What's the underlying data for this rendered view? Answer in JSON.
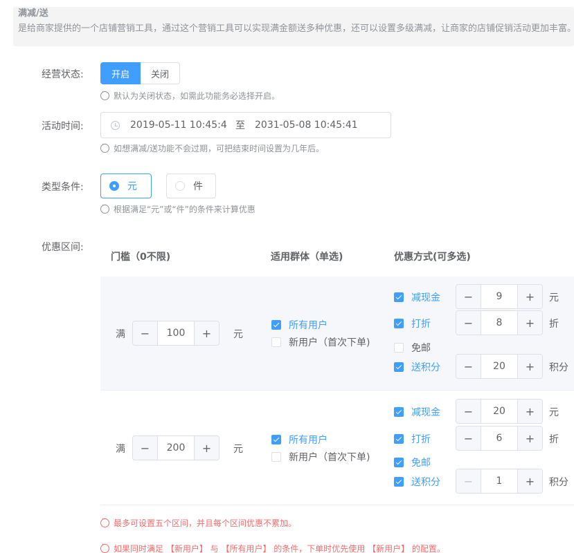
{
  "header": {
    "title": "满减/送",
    "description": "是给商家提供的一个店铺营销工具，通过这个营销工具可以实现满金额送多种优惠，还可以设置多级满减，让商家的店铺促销活动更加丰富。"
  },
  "status": {
    "label": "经营状态:",
    "options": [
      "开启",
      "关闭"
    ],
    "selected": "开启",
    "hint": "默认为关闭状态，如需此功能务必选择开启。"
  },
  "time": {
    "label": "活动时间:",
    "start": "2019-05-11 10:45:41",
    "separator": "至",
    "end": "2031-05-08 10:45:41",
    "hint": "如想满减/送功能不会过期，可把结束时间设置为几年后。"
  },
  "type": {
    "label": "类型条件:",
    "options": [
      "元",
      "件"
    ],
    "selected": "元",
    "hint": "根据满足“元”或“件”的条件来计算优惠"
  },
  "tiers": {
    "label": "优惠区间:",
    "headers": [
      "门槛（0不限)",
      "适用群体（单选)",
      "优惠方式(可多选)"
    ],
    "threshold_prefix": "满",
    "threshold_unit": "元",
    "group_options": [
      "所有用户",
      "新用户（首次下单)"
    ],
    "rows": [
      {
        "threshold": "100",
        "group": "所有用户",
        "discounts": [
          {
            "name": "减现金",
            "checked": true,
            "value": "9",
            "unit": "元"
          },
          {
            "name": "打折",
            "checked": true,
            "value": "8",
            "unit": "折"
          },
          {
            "name": "免邮",
            "checked": false
          },
          {
            "name": "送积分",
            "checked": true,
            "value": "20",
            "unit": "积分"
          }
        ]
      },
      {
        "threshold": "200",
        "group": "所有用户",
        "discounts": [
          {
            "name": "减现金",
            "checked": true,
            "value": "20",
            "unit": "元"
          },
          {
            "name": "打折",
            "checked": true,
            "value": "6",
            "unit": "折"
          },
          {
            "name": "免邮",
            "checked": true
          },
          {
            "name": "送积分",
            "checked": true,
            "value": "1",
            "unit": "积分"
          }
        ]
      }
    ],
    "stepper_minus": "−",
    "stepper_plus": "+",
    "notes": [
      "最多可设置五个区间，并且每个区间优惠不累加。",
      "如果同时满足 【新用户】 与 【所有用户】 的条件，下单时优先使用 【新用户】 的配置。"
    ]
  },
  "colors": {
    "primary": "#409eff",
    "danger": "#f56c6c",
    "muted": "#909399"
  }
}
